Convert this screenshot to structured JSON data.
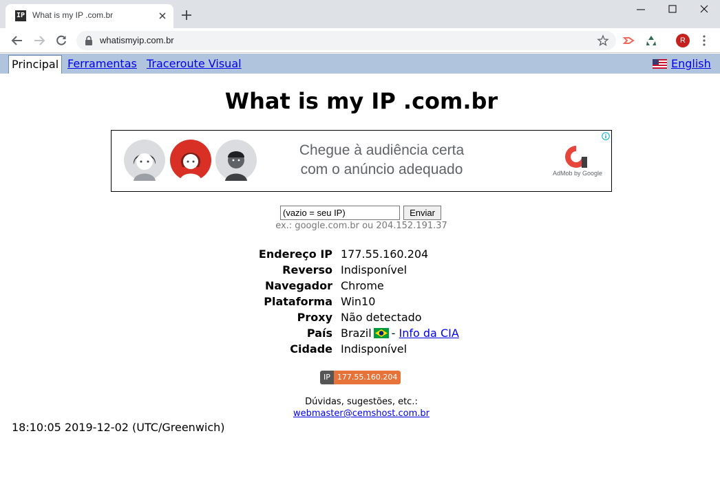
{
  "browser": {
    "tab_title": "What is my IP .com.br",
    "favicon_text": "IP",
    "url": "whatismyip.com.br",
    "profile_initial": "R"
  },
  "nav": {
    "active_tab": "Principal",
    "links": [
      "Ferramentas",
      "Traceroute Visual"
    ],
    "language_link": "English"
  },
  "page_title": "What is my IP .com.br",
  "ad": {
    "text_line1": "Chegue à audiência certa",
    "text_line2": "com o anúncio adequado",
    "brand": "AdMob by Google",
    "info_icon": "info-icon"
  },
  "lookup": {
    "input_value": "(vazio = seu IP)",
    "button_label": "Enviar",
    "example": "ex.: google.com.br ou 204.152.191.37"
  },
  "info": [
    {
      "label": "Endereço IP",
      "value": "177.55.160.204"
    },
    {
      "label": "Reverso",
      "value": "Indisponível"
    },
    {
      "label": "Navegador",
      "value": "Chrome"
    },
    {
      "label": "Plataforma",
      "value": "Win10"
    },
    {
      "label": "Proxy",
      "value": "Não detectado"
    },
    {
      "label": "País",
      "value": "Brazil",
      "separator": "-",
      "link": "Info da CIA"
    },
    {
      "label": "Cidade",
      "value": "Indisponível"
    }
  ],
  "badge": {
    "left": "IP",
    "right": "177.55.160.204"
  },
  "contact": {
    "text": "Dúvidas, sugestões, etc.:",
    "email": "webmaster@cemshost.com.br"
  },
  "timestamp": "18:10:05 2019-12-02 (UTC/Greenwich)",
  "colors": {
    "nav_bar": "#b0c4de",
    "link": "#0000ee",
    "badge_right": "#e5733a",
    "badge_left": "#555555"
  }
}
